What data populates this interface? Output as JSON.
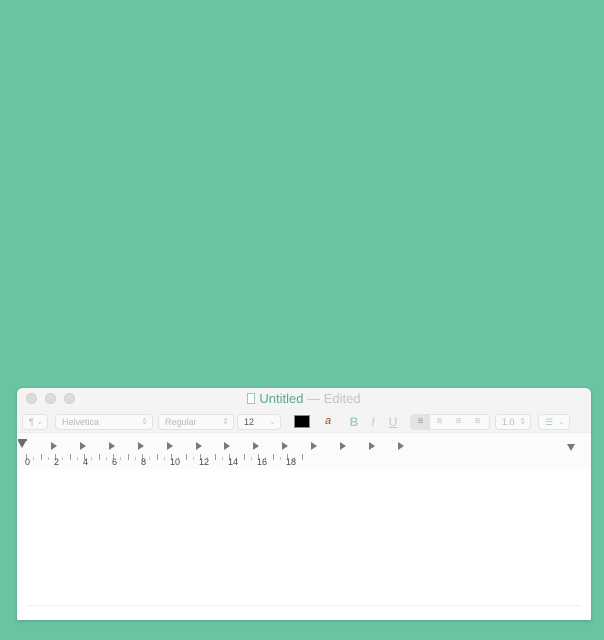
{
  "window": {
    "title": "Untitled",
    "separator": "—",
    "status": "Edited"
  },
  "toolbar": {
    "paragraph_style_label": "¶",
    "font_family": "Helvetica",
    "font_style": "Regular",
    "font_size": "12",
    "text_color": "#000000",
    "highlight_glyph": "a",
    "bold_label": "B",
    "italic_label": "I",
    "underline_label": "U",
    "line_spacing": "1.0",
    "list_glyph": "☰"
  },
  "ruler": {
    "tab_stop_count": 13,
    "numbers": [
      "0",
      "2",
      "4",
      "6",
      "8",
      "10",
      "12",
      "14",
      "16",
      "18"
    ]
  },
  "document": {
    "text": ""
  }
}
